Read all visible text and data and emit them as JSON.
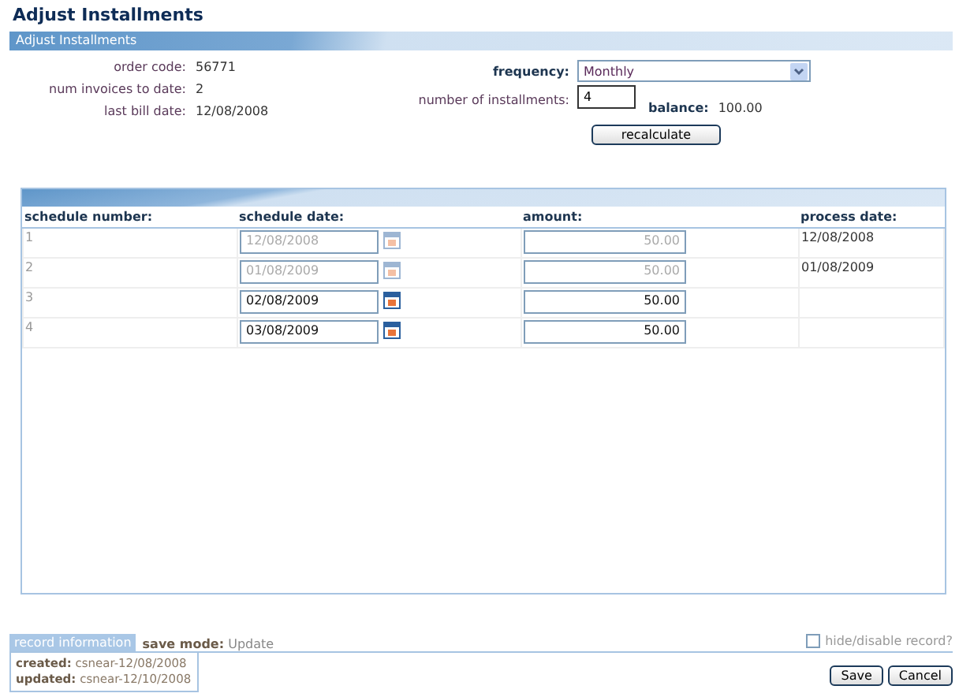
{
  "page_title": "Adjust Installments",
  "section_title": "Adjust Installments",
  "summary": [
    {
      "label": "order code:",
      "value": "56771"
    },
    {
      "label": "num invoices to date:",
      "value": "2"
    },
    {
      "label": "last bill date:",
      "value": "12/08/2008"
    }
  ],
  "frequency": {
    "label": "frequency:",
    "value": "Monthly"
  },
  "installments": {
    "label": "number of installments:",
    "value": "4"
  },
  "balance": {
    "label": "balance:",
    "value": "100.00"
  },
  "recalculate_button": "recalculate",
  "table": {
    "columns": [
      "schedule number:",
      "schedule date:",
      "amount:",
      "process date:"
    ],
    "rows": [
      {
        "number": "1",
        "date": "12/08/2008",
        "amount": "50.00",
        "process_date": "12/08/2008",
        "disabled": true
      },
      {
        "number": "2",
        "date": "01/08/2009",
        "amount": "50.00",
        "process_date": "01/08/2009",
        "disabled": true
      },
      {
        "number": "3",
        "date": "02/08/2009",
        "amount": "50.00",
        "disabled": false
      },
      {
        "number": "4",
        "date": "03/08/2009",
        "amount": "50.00",
        "disabled": false
      }
    ]
  },
  "record_info": {
    "tab": "record information",
    "save_mode_label": "save mode:",
    "save_mode": "Update",
    "created_label": "created:",
    "created": "csnear-12/08/2008",
    "updated_label": "updated:",
    "updated": "csnear-12/10/2008"
  },
  "hide_record": {
    "label": "hide/disable record?",
    "checked": false
  },
  "buttons": [
    "Save",
    "Cancel"
  ]
}
